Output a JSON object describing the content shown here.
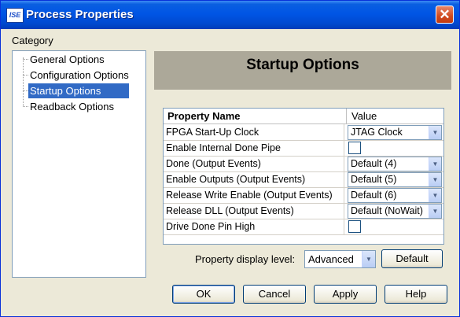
{
  "window": {
    "title": "Process Properties",
    "app_icon_text": "ISE",
    "close_glyph": "✕",
    "close_icon": "close-icon"
  },
  "category": {
    "label": "Category",
    "items": [
      {
        "label": "General Options",
        "selected": false
      },
      {
        "label": "Configuration Options",
        "selected": false
      },
      {
        "label": "Startup Options",
        "selected": true
      },
      {
        "label": "Readback Options",
        "selected": false
      }
    ]
  },
  "panel": {
    "title": "Startup Options"
  },
  "grid": {
    "headers": {
      "name": "Property Name",
      "value": "Value"
    },
    "rows": [
      {
        "name": "FPGA Start-Up Clock",
        "type": "combo",
        "value": "JTAG Clock"
      },
      {
        "name": "Enable Internal Done Pipe",
        "type": "checkbox",
        "checked": false
      },
      {
        "name": "Done (Output Events)",
        "type": "combo",
        "value": "Default (4)"
      },
      {
        "name": "Enable Outputs (Output Events)",
        "type": "combo",
        "value": "Default (5)"
      },
      {
        "name": "Release Write Enable (Output Events)",
        "type": "combo",
        "value": "Default (6)"
      },
      {
        "name": "Release DLL (Output Events)",
        "type": "combo",
        "value": "Default (NoWait)"
      },
      {
        "name": "Drive Done Pin High",
        "type": "checkbox",
        "checked": false
      }
    ]
  },
  "display_level": {
    "label": "Property display level:",
    "value": "Advanced",
    "default_button": "Default"
  },
  "buttons": {
    "ok": "OK",
    "cancel": "Cancel",
    "apply": "Apply",
    "help": "Help"
  },
  "dropdown_glyph": "▼",
  "colors": {
    "titlebar": "#0055e5",
    "selection": "#316ac5",
    "panel_header": "#aca899",
    "dialog_bg": "#ece9d8"
  }
}
